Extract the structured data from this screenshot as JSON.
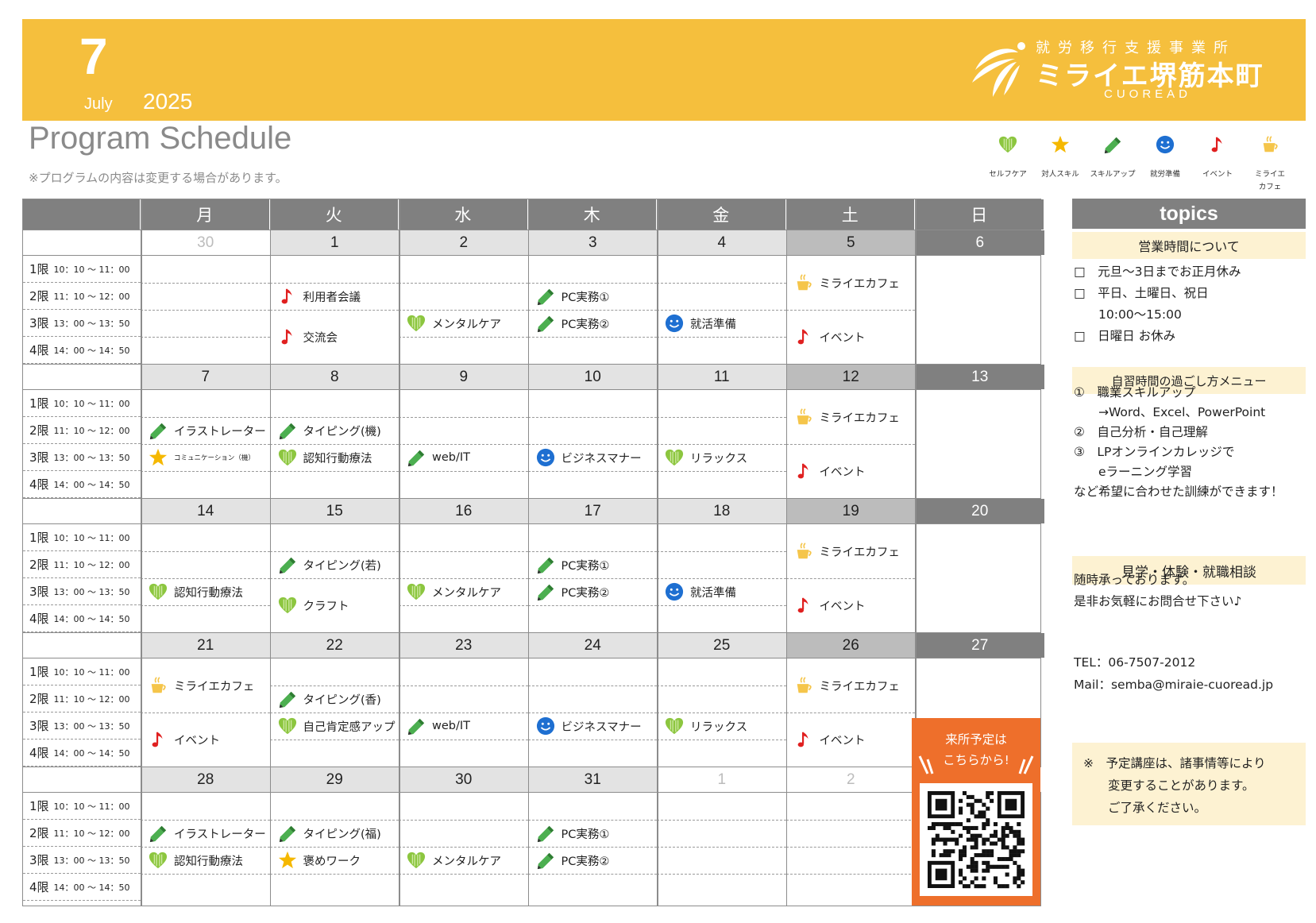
{
  "header": {
    "month_number": "7",
    "month_name": "July",
    "year": "2025",
    "brand_sub": "就労移行支援事業所",
    "brand_main": "ミライエ堺筋本町",
    "brand_en": "CUOREAD"
  },
  "title": "Program Schedule",
  "notice": "※プログラムの内容は変更する場合があります。",
  "colors": {
    "banner": "#f5bf3d",
    "header_gray": "#808080",
    "date_gray": "#e3e3e3",
    "sat_gray": "#bcbcbc",
    "qr_orange": "#ee6f2b",
    "topics_band": "#fdf2d2",
    "heart_green": "#8cc63f",
    "star_yellow": "#f5b800",
    "pencil_green": "#4caf50",
    "smile_blue": "#1e6fd1",
    "note_red": "#e02020",
    "cup_yellow": "#f5c54a"
  },
  "legend": [
    {
      "icon": "heart-icon",
      "label": "セルフケア"
    },
    {
      "icon": "star-icon",
      "label": "対人スキル"
    },
    {
      "icon": "pencil-icon",
      "label": "スキルアップ"
    },
    {
      "icon": "smile-icon",
      "label": "就労準備"
    },
    {
      "icon": "music-note-icon",
      "label": "イベント"
    },
    {
      "icon": "cup-icon",
      "label": "ミライエ\nカフェ"
    }
  ],
  "weekdays": [
    "月",
    "火",
    "水",
    "木",
    "金",
    "土",
    "日"
  ],
  "periods": [
    {
      "name": "1限",
      "time": "10：10 ～ 11：00"
    },
    {
      "name": "2限",
      "time": "11：10 ～ 12：00"
    },
    {
      "name": "3限",
      "time": "13：00 ～ 13：50"
    },
    {
      "name": "4限",
      "time": "14：00 ～ 14：50"
    }
  ],
  "weeks": [
    {
      "dates": [
        "30",
        "1",
        "2",
        "3",
        "4",
        "5",
        "6"
      ],
      "other": [
        true,
        false,
        false,
        false,
        false,
        false,
        false
      ],
      "events": [
        {
          "day": 1,
          "p": 1,
          "span": 1,
          "icon": "note",
          "text": "利用者会議"
        },
        {
          "day": 1,
          "p": 2,
          "span": 2,
          "icon": "note",
          "text": "交流会"
        },
        {
          "day": 2,
          "p": 2,
          "span": 1,
          "icon": "heart",
          "text": "メンタルケア"
        },
        {
          "day": 3,
          "p": 1,
          "span": 1,
          "icon": "pencil",
          "text": "PC実務①"
        },
        {
          "day": 3,
          "p": 2,
          "span": 1,
          "icon": "pencil",
          "text": "PC実務②"
        },
        {
          "day": 4,
          "p": 2,
          "span": 1,
          "icon": "smile",
          "text": "就活準備"
        },
        {
          "day": 5,
          "p": 0,
          "span": 2,
          "icon": "cup",
          "text": "ミライエカフェ"
        },
        {
          "day": 5,
          "p": 2,
          "span": 2,
          "icon": "note",
          "text": "イベント"
        }
      ]
    },
    {
      "dates": [
        "7",
        "8",
        "9",
        "10",
        "11",
        "12",
        "13"
      ],
      "other": [
        false,
        false,
        false,
        false,
        false,
        false,
        false
      ],
      "events": [
        {
          "day": 0,
          "p": 1,
          "span": 1,
          "icon": "pencil",
          "text": "イラストレーター"
        },
        {
          "day": 0,
          "p": 2,
          "span": 1,
          "icon": "star",
          "text": "コミュニケーション（機）",
          "small": true
        },
        {
          "day": 1,
          "p": 1,
          "span": 1,
          "icon": "pencil",
          "text": "タイピング(機)"
        },
        {
          "day": 1,
          "p": 2,
          "span": 1,
          "icon": "heart",
          "text": "認知行動療法"
        },
        {
          "day": 2,
          "p": 2,
          "span": 1,
          "icon": "pencil",
          "text": "web/IT"
        },
        {
          "day": 3,
          "p": 2,
          "span": 1,
          "icon": "smile",
          "text": "ビジネスマナー"
        },
        {
          "day": 4,
          "p": 2,
          "span": 1,
          "icon": "heart",
          "text": "リラックス"
        },
        {
          "day": 5,
          "p": 0,
          "span": 2,
          "icon": "cup",
          "text": "ミライエカフェ"
        },
        {
          "day": 5,
          "p": 2,
          "span": 2,
          "icon": "note",
          "text": "イベント"
        }
      ]
    },
    {
      "dates": [
        "14",
        "15",
        "16",
        "17",
        "18",
        "19",
        "20"
      ],
      "other": [
        false,
        false,
        false,
        false,
        false,
        false,
        false
      ],
      "events": [
        {
          "day": 0,
          "p": 2,
          "span": 1,
          "icon": "heart",
          "text": "認知行動療法"
        },
        {
          "day": 1,
          "p": 1,
          "span": 1,
          "icon": "pencil",
          "text": "タイピング(若)"
        },
        {
          "day": 1,
          "p": 2,
          "span": 2,
          "icon": "heart",
          "text": "クラフト"
        },
        {
          "day": 2,
          "p": 2,
          "span": 1,
          "icon": "heart",
          "text": "メンタルケア"
        },
        {
          "day": 3,
          "p": 1,
          "span": 1,
          "icon": "pencil",
          "text": "PC実務①"
        },
        {
          "day": 3,
          "p": 2,
          "span": 1,
          "icon": "pencil",
          "text": "PC実務②"
        },
        {
          "day": 4,
          "p": 2,
          "span": 1,
          "icon": "smile",
          "text": "就活準備"
        },
        {
          "day": 5,
          "p": 0,
          "span": 2,
          "icon": "cup",
          "text": "ミライエカフェ"
        },
        {
          "day": 5,
          "p": 2,
          "span": 2,
          "icon": "note",
          "text": "イベント"
        }
      ]
    },
    {
      "dates": [
        "21",
        "22",
        "23",
        "24",
        "25",
        "26",
        "27"
      ],
      "other": [
        false,
        false,
        false,
        false,
        false,
        false,
        false
      ],
      "events": [
        {
          "day": 0,
          "p": 0,
          "span": 2,
          "icon": "cup",
          "text": "ミライエカフェ"
        },
        {
          "day": 0,
          "p": 2,
          "span": 2,
          "icon": "note",
          "text": "イベント"
        },
        {
          "day": 1,
          "p": 1,
          "span": 1,
          "icon": "pencil",
          "text": "タイピング(香)"
        },
        {
          "day": 1,
          "p": 2,
          "span": 1,
          "icon": "heart",
          "text": "自己肯定感アップ"
        },
        {
          "day": 2,
          "p": 2,
          "span": 1,
          "icon": "pencil",
          "text": "web/IT"
        },
        {
          "day": 3,
          "p": 2,
          "span": 1,
          "icon": "smile",
          "text": "ビジネスマナー"
        },
        {
          "day": 4,
          "p": 2,
          "span": 1,
          "icon": "heart",
          "text": "リラックス"
        },
        {
          "day": 5,
          "p": 0,
          "span": 2,
          "icon": "cup",
          "text": "ミライエカフェ"
        },
        {
          "day": 5,
          "p": 2,
          "span": 2,
          "icon": "note",
          "text": "イベント"
        }
      ]
    },
    {
      "dates": [
        "28",
        "29",
        "30",
        "31",
        "1",
        "2",
        ""
      ],
      "other": [
        false,
        false,
        false,
        false,
        true,
        true,
        false
      ],
      "events": [
        {
          "day": 0,
          "p": 1,
          "span": 1,
          "icon": "pencil",
          "text": "イラストレーター"
        },
        {
          "day": 0,
          "p": 2,
          "span": 1,
          "icon": "heart",
          "text": "認知行動療法"
        },
        {
          "day": 1,
          "p": 1,
          "span": 1,
          "icon": "pencil",
          "text": "タイピング(福)"
        },
        {
          "day": 1,
          "p": 2,
          "span": 1,
          "icon": "star",
          "text": "褒めワーク"
        },
        {
          "day": 2,
          "p": 2,
          "span": 1,
          "icon": "heart",
          "text": "メンタルケア"
        },
        {
          "day": 3,
          "p": 1,
          "span": 1,
          "icon": "pencil",
          "text": "PC実務①"
        },
        {
          "day": 3,
          "p": 2,
          "span": 1,
          "icon": "pencil",
          "text": "PC実務②"
        }
      ]
    }
  ],
  "qr": {
    "line1": "来所予定は",
    "line2": "こちらから!"
  },
  "topics": {
    "title": "topics",
    "hours_title": "営業時間について",
    "hours": [
      "□　元旦～3日までお正月休み",
      "□　平日、土曜日、祝日",
      "　　10:00～15:00",
      "□　日曜日 お休み"
    ],
    "self_title": "自習時間の過ごし方メニュー",
    "self": [
      "①　職業スキルアップ",
      "　　→Word、Excel、PowerPoint",
      "②　自己分析・自己理解",
      "③　LPオンラインカレッジで",
      "　　eラーニング学習",
      "など希望に合わせた訓練ができます！"
    ],
    "visit_title": "見学・体験・就職相談",
    "visit": [
      "随時承っております。",
      "是非お気軽にお問合せ下さい♪"
    ],
    "tel": "TEL：06-7507-2012",
    "mail": "Mail：semba@miraie-cuoread.jp",
    "note": [
      "※　予定講座は、諸事情等により",
      "　　変更することがあります。",
      "　　ご了承ください。"
    ]
  }
}
